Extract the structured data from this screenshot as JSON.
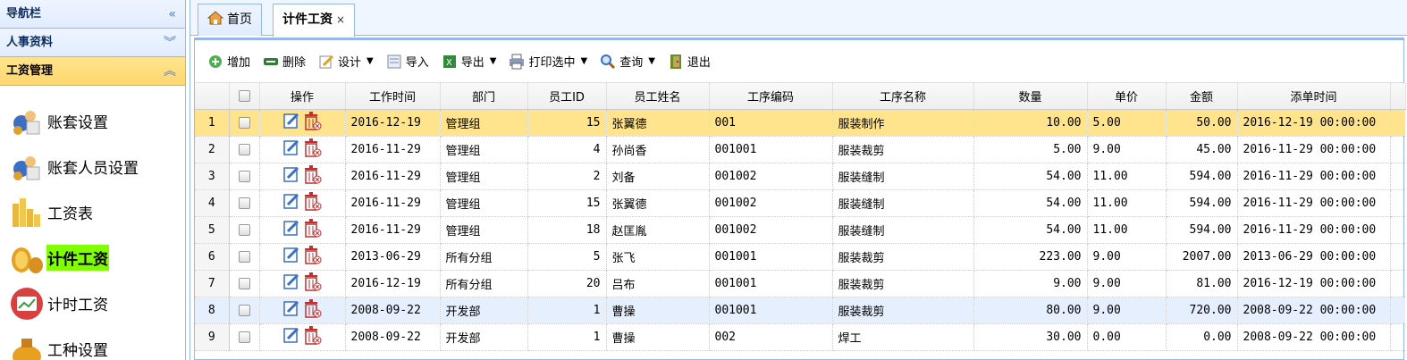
{
  "nav": {
    "title": "导航栏",
    "collapse_icon": "double-chevron-left-icon",
    "sections": [
      {
        "label": "人事资料",
        "icon": "double-chevron-down-icon"
      },
      {
        "label": "工资管理",
        "icon": "double-chevron-up-icon"
      }
    ],
    "items": [
      {
        "label": "账套设置"
      },
      {
        "label": "账套人员设置"
      },
      {
        "label": "工资表"
      },
      {
        "label": "计件工资"
      },
      {
        "label": "计时工资"
      },
      {
        "label": "工种设置"
      }
    ]
  },
  "tabs": [
    {
      "label": "首页"
    },
    {
      "label": "计件工资",
      "close": "×"
    }
  ],
  "toolbar": {
    "add": "增加",
    "delete": "删除",
    "design": "设计",
    "import": "导入",
    "export": "导出",
    "print": "打印选中",
    "query": "查询",
    "exit": "退出"
  },
  "columns": [
    "操作",
    "工作时间",
    "部门",
    "员工ID",
    "员工姓名",
    "工序编码",
    "工序名称",
    "数量",
    "单价",
    "金额",
    "添单时间"
  ],
  "rows": [
    {
      "n": "1",
      "date": "2016-12-19",
      "dept": "管理组",
      "id": "15",
      "name": "张翼德",
      "code": "001",
      "proc": "服装制作",
      "qty": "10.00",
      "price": "5.00",
      "amt": "50.00",
      "time": "2016-12-19 00:00:00"
    },
    {
      "n": "2",
      "date": "2016-11-29",
      "dept": "管理组",
      "id": "4",
      "name": "孙尚香",
      "code": "001001",
      "proc": "服装裁剪",
      "qty": "5.00",
      "price": "9.00",
      "amt": "45.00",
      "time": "2016-11-29 00:00:00"
    },
    {
      "n": "3",
      "date": "2016-11-29",
      "dept": "管理组",
      "id": "2",
      "name": "刘备",
      "code": "001002",
      "proc": "服装缝制",
      "qty": "54.00",
      "price": "11.00",
      "amt": "594.00",
      "time": "2016-11-29 00:00:00"
    },
    {
      "n": "4",
      "date": "2016-11-29",
      "dept": "管理组",
      "id": "15",
      "name": "张翼德",
      "code": "001002",
      "proc": "服装缝制",
      "qty": "54.00",
      "price": "11.00",
      "amt": "594.00",
      "time": "2016-11-29 00:00:00"
    },
    {
      "n": "5",
      "date": "2016-11-29",
      "dept": "管理组",
      "id": "18",
      "name": "赵匡胤",
      "code": "001002",
      "proc": "服装缝制",
      "qty": "54.00",
      "price": "11.00",
      "amt": "594.00",
      "time": "2016-11-29 00:00:00"
    },
    {
      "n": "6",
      "date": "2013-06-29",
      "dept": "所有分组",
      "id": "5",
      "name": "张飞",
      "code": "001001",
      "proc": "服装裁剪",
      "qty": "223.00",
      "price": "9.00",
      "amt": "2007.00",
      "time": "2013-06-29 00:00:00"
    },
    {
      "n": "7",
      "date": "2016-12-19",
      "dept": "所有分组",
      "id": "20",
      "name": "吕布",
      "code": "001001",
      "proc": "服装裁剪",
      "qty": "9.00",
      "price": "9.00",
      "amt": "81.00",
      "time": "2016-12-19 00:00:00"
    },
    {
      "n": "8",
      "date": "2008-09-22",
      "dept": "开发部",
      "id": "1",
      "name": "曹操",
      "code": "001001",
      "proc": "服装裁剪",
      "qty": "80.00",
      "price": "9.00",
      "amt": "720.00",
      "time": "2008-09-22 00:00:00"
    },
    {
      "n": "9",
      "date": "2008-09-22",
      "dept": "开发部",
      "id": "1",
      "name": "曹操",
      "code": "002",
      "proc": "焊工",
      "qty": "30.00",
      "price": "0.00",
      "amt": "0.00",
      "time": "2008-09-22 00:00:00"
    }
  ],
  "colors": {
    "selected_row": "#ffe48d",
    "hover_row": "#e6effe",
    "border": "#95b8e7",
    "active_nav": "#7fff00"
  }
}
